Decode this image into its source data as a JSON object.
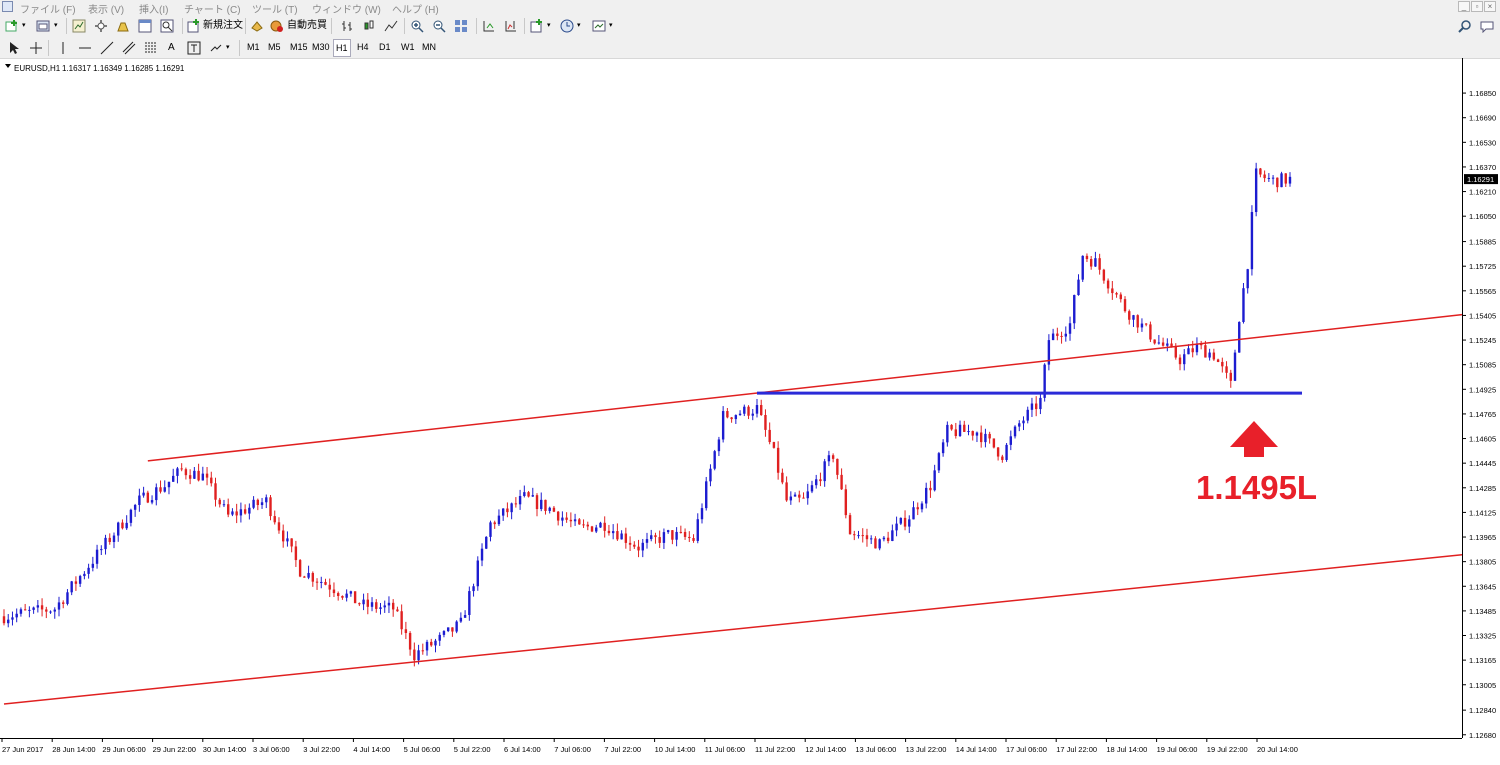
{
  "menu": [
    "ファイル (F)",
    "表示 (V)",
    "挿入(I)",
    "チャート (C)",
    "ツール (T)",
    "ウィンドウ (W)",
    "ヘルプ (H)"
  ],
  "toolbar": {
    "new_order_label": "新規注文",
    "auto_trade_label": "自動売買"
  },
  "timeframes": [
    "M1",
    "M5",
    "M15",
    "M30",
    "H1",
    "H4",
    "D1",
    "W1",
    "MN"
  ],
  "active_timeframe": "H1",
  "icons": [
    "new-chart-icon",
    "profiles-icon",
    "market-watch-icon",
    "navigator-icon",
    "data-window-icon",
    "terminal-icon",
    "tester-icon",
    "bar-chart-icon",
    "candle-chart-icon",
    "line-chart-icon",
    "zoom-in-icon",
    "zoom-out-icon",
    "tile-icon",
    "autoscroll-icon",
    "chart-shift-icon",
    "indicators-icon",
    "periods-icon",
    "templates-icon",
    "cursor-icon",
    "crosshair-icon",
    "vertical-line-icon",
    "horizontal-line-icon",
    "trendline-icon",
    "channel-icon",
    "fibonacci-icon",
    "text-icon",
    "text-label-icon",
    "arrows-icon",
    "search-icon",
    "chat-icon"
  ],
  "chart_header": {
    "symbol": "EURUSD,H1",
    "ohlc": "1.16317 1.16349 1.16285 1.16291"
  },
  "current_price": "1.16291",
  "annotation": {
    "label": "1.1495L",
    "color": "#e8202a"
  },
  "colors": {
    "bull": "#1c1cd0",
    "bear": "#e02020",
    "channel": "#e02020",
    "level": "#2a2ad8"
  },
  "chart_data": {
    "type": "candlestick",
    "symbol": "EURUSD",
    "timeframe": "H1",
    "price_ticks": [
      "1.16850",
      "1.16690",
      "1.16530",
      "1.16370",
      "1.16210",
      "1.16050",
      "1.15885",
      "1.15725",
      "1.15565",
      "1.15405",
      "1.15245",
      "1.15085",
      "1.14925",
      "1.14765",
      "1.14605",
      "1.14445",
      "1.14285",
      "1.14125",
      "1.13965",
      "1.13805",
      "1.13645",
      "1.13485",
      "1.13325",
      "1.13165",
      "1.13005",
      "1.12840",
      "1.12680"
    ],
    "ylim": [
      1.1262,
      1.17
    ],
    "time_labels": [
      "27 Jun 2017",
      "28 Jun 14:00",
      "29 Jun 06:00",
      "29 Jun 22:00",
      "30 Jun 14:00",
      "3 Jul 06:00",
      "3 Jul 22:00",
      "4 Jul 14:00",
      "5 Jul 06:00",
      "5 Jul 22:00",
      "6 Jul 14:00",
      "7 Jul 06:00",
      "7 Jul 22:00",
      "10 Jul 14:00",
      "11 Jul 06:00",
      "11 Jul 22:00",
      "12 Jul 14:00",
      "13 Jul 06:00",
      "13 Jul 22:00",
      "14 Jul 14:00",
      "17 Jul 06:00",
      "17 Jul 22:00",
      "18 Jul 14:00",
      "19 Jul 06:00",
      "19 Jul 22:00",
      "20 Jul 14:00"
    ],
    "bar_count": 320,
    "path_points": [
      {
        "bar": 0,
        "price": 1.1345
      },
      {
        "bar": 12,
        "price": 1.135
      },
      {
        "bar": 22,
        "price": 1.1385
      },
      {
        "bar": 32,
        "price": 1.142
      },
      {
        "bar": 38,
        "price": 1.143
      },
      {
        "bar": 42,
        "price": 1.144
      },
      {
        "bar": 47,
        "price": 1.1436
      },
      {
        "bar": 53,
        "price": 1.141
      },
      {
        "bar": 62,
        "price": 1.142
      },
      {
        "bar": 70,
        "price": 1.1375
      },
      {
        "bar": 75,
        "price": 1.1368
      },
      {
        "bar": 80,
        "price": 1.136
      },
      {
        "bar": 85,
        "price": 1.1352
      },
      {
        "bar": 92,
        "price": 1.135
      },
      {
        "bar": 97,
        "price": 1.132
      },
      {
        "bar": 103,
        "price": 1.133
      },
      {
        "bar": 108,
        "price": 1.134
      },
      {
        "bar": 115,
        "price": 1.1405
      },
      {
        "bar": 123,
        "price": 1.1422
      },
      {
        "bar": 129,
        "price": 1.1415
      },
      {
        "bar": 136,
        "price": 1.1402
      },
      {
        "bar": 142,
        "price": 1.1405
      },
      {
        "bar": 150,
        "price": 1.139
      },
      {
        "bar": 157,
        "price": 1.1398
      },
      {
        "bar": 163,
        "price": 1.1395
      },
      {
        "bar": 167,
        "price": 1.144
      },
      {
        "bar": 170,
        "price": 1.1475
      },
      {
        "bar": 178,
        "price": 1.148
      },
      {
        "bar": 182,
        "price": 1.145
      },
      {
        "bar": 185,
        "price": 1.142
      },
      {
        "bar": 189,
        "price": 1.142
      },
      {
        "bar": 196,
        "price": 1.145
      },
      {
        "bar": 200,
        "price": 1.14
      },
      {
        "bar": 207,
        "price": 1.1392
      },
      {
        "bar": 214,
        "price": 1.141
      },
      {
        "bar": 219,
        "price": 1.143
      },
      {
        "bar": 223,
        "price": 1.1465
      },
      {
        "bar": 230,
        "price": 1.1465
      },
      {
        "bar": 236,
        "price": 1.145
      },
      {
        "bar": 240,
        "price": 1.147
      },
      {
        "bar": 245,
        "price": 1.1485
      },
      {
        "bar": 247,
        "price": 1.1525
      },
      {
        "bar": 252,
        "price": 1.1535
      },
      {
        "bar": 255,
        "price": 1.158
      },
      {
        "bar": 258,
        "price": 1.1575
      },
      {
        "bar": 265,
        "price": 1.1545
      },
      {
        "bar": 272,
        "price": 1.1525
      },
      {
        "bar": 278,
        "price": 1.1512
      },
      {
        "bar": 282,
        "price": 1.152
      },
      {
        "bar": 286,
        "price": 1.1515
      },
      {
        "bar": 290,
        "price": 1.1495
      },
      {
        "bar": 292,
        "price": 1.154
      },
      {
        "bar": 294,
        "price": 1.1575
      },
      {
        "bar": 296,
        "price": 1.1632
      },
      {
        "bar": 300,
        "price": 1.1628
      },
      {
        "bar": 304,
        "price": 1.1629
      }
    ],
    "channel": {
      "upper": {
        "from": {
          "bar": 34,
          "price": 1.1446
        },
        "to": {
          "bar": 345,
          "price": 1.1541
        }
      },
      "lower": {
        "from": {
          "bar": 0,
          "price": 1.1288
        },
        "to": {
          "bar": 345,
          "price": 1.1385
        }
      }
    },
    "horizontal_level": {
      "price": 1.149,
      "label": "1.1495L"
    }
  }
}
